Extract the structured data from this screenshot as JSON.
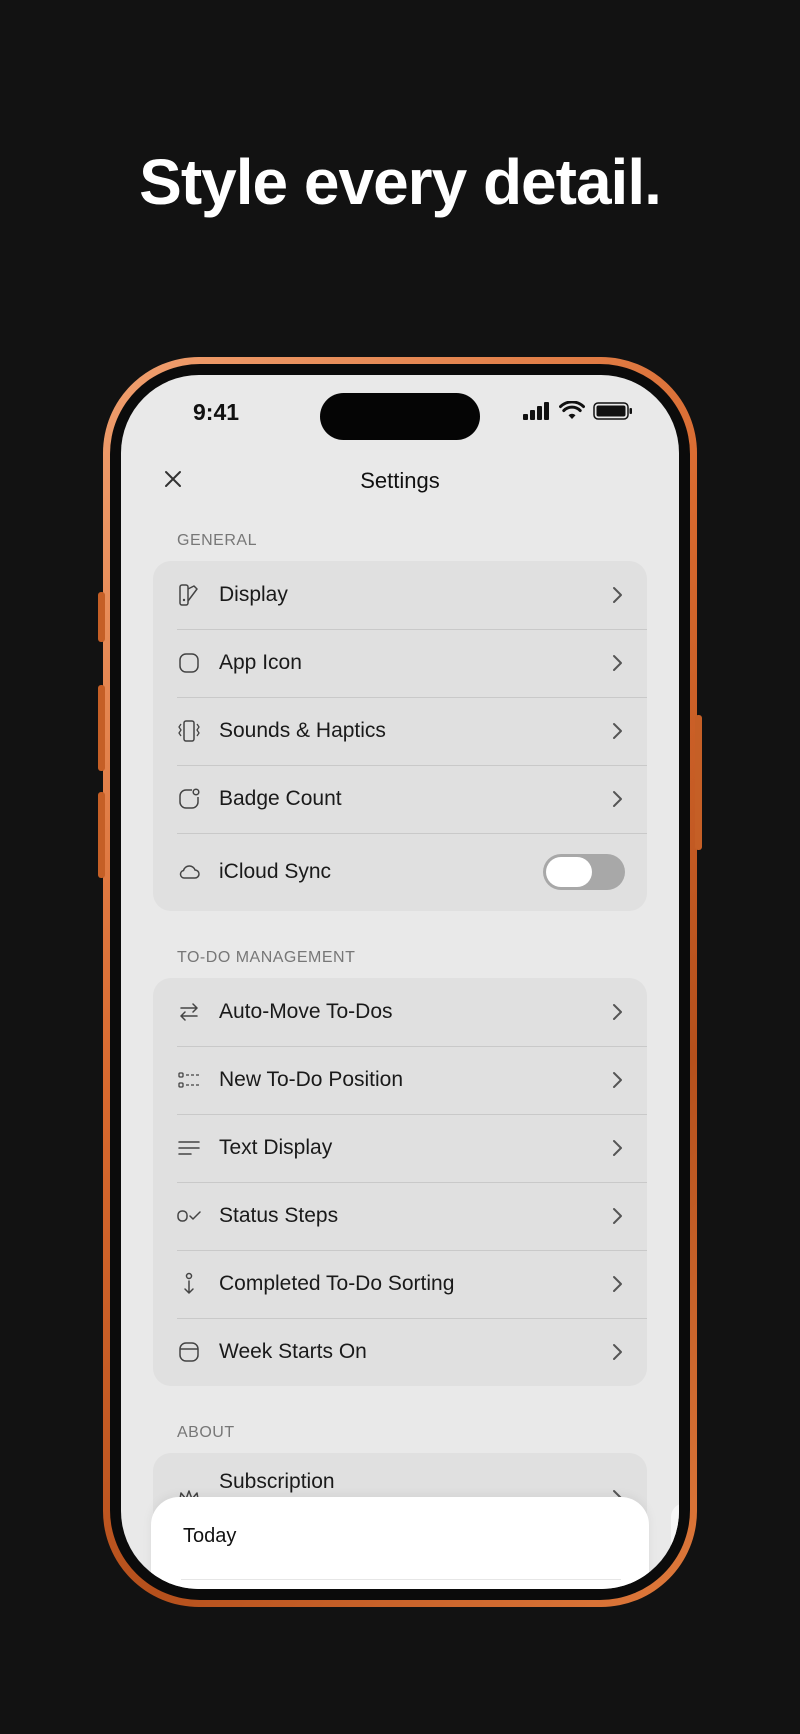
{
  "headline": "Style every detail.",
  "status_bar": {
    "time": "9:41"
  },
  "nav": {
    "title": "Settings"
  },
  "sections": [
    {
      "label": "GENERAL",
      "rows": [
        {
          "label": "Display",
          "icon": "display-palette-icon",
          "accessory": "chevron"
        },
        {
          "label": "App Icon",
          "icon": "app-icon-icon",
          "accessory": "chevron"
        },
        {
          "label": "Sounds & Haptics",
          "icon": "haptics-icon",
          "accessory": "chevron"
        },
        {
          "label": "Badge Count",
          "icon": "badge-icon",
          "accessory": "chevron"
        },
        {
          "label": "iCloud Sync",
          "icon": "cloud-icon",
          "accessory": "toggle",
          "toggle_on": false
        }
      ]
    },
    {
      "label": "TO-DO MANAGEMENT",
      "rows": [
        {
          "label": "Auto-Move To-Dos",
          "icon": "arrows-swap-icon",
          "accessory": "chevron"
        },
        {
          "label": "New To-Do Position",
          "icon": "list-position-icon",
          "accessory": "chevron"
        },
        {
          "label": "Text Display",
          "icon": "text-lines-icon",
          "accessory": "chevron"
        },
        {
          "label": "Status Steps",
          "icon": "status-steps-icon",
          "accessory": "chevron"
        },
        {
          "label": "Completed To-Do Sorting",
          "icon": "sort-down-icon",
          "accessory": "chevron"
        },
        {
          "label": "Week Starts On",
          "icon": "calendar-icon",
          "accessory": "chevron"
        }
      ]
    },
    {
      "label": "ABOUT",
      "rows": [
        {
          "label": "Subscription",
          "icon": "crown-icon",
          "accessory": "chevron"
        }
      ]
    }
  ],
  "sheet": {
    "label": "Today"
  },
  "colors": {
    "frame": "#d8692e",
    "screen_bg": "#e9e9e9",
    "group_bg": "#e0e0e0"
  }
}
